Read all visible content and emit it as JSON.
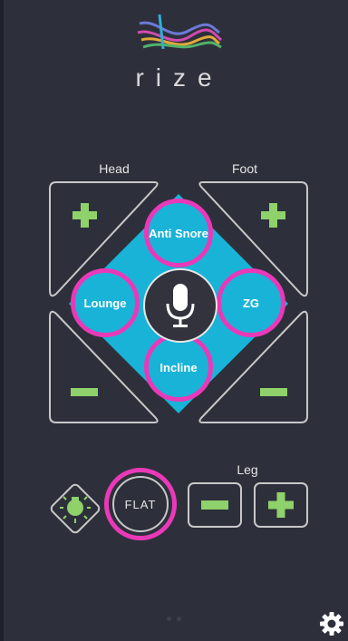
{
  "app": {
    "logo_text": "rize"
  },
  "labels": {
    "head": "Head",
    "foot": "Foot",
    "leg": "Leg"
  },
  "modes": {
    "anti_snore": "Anti Snore",
    "lounge": "Lounge",
    "zg": "ZG",
    "incline": "Incline"
  },
  "controls": {
    "flat": "FLAT"
  },
  "icons": {
    "mic": "microphone-icon",
    "light": "light-bulb-icon",
    "settings": "gear-icon",
    "plus": "plus-icon",
    "minus": "minus-icon"
  },
  "colors": {
    "background": "#2d303b",
    "accent_cyan": "#19b3d8",
    "highlight_pink": "#ea39b8",
    "green": "#8fd16a",
    "outline": "#c8c8c8"
  },
  "pager": {
    "pages": 2,
    "current": 1
  }
}
